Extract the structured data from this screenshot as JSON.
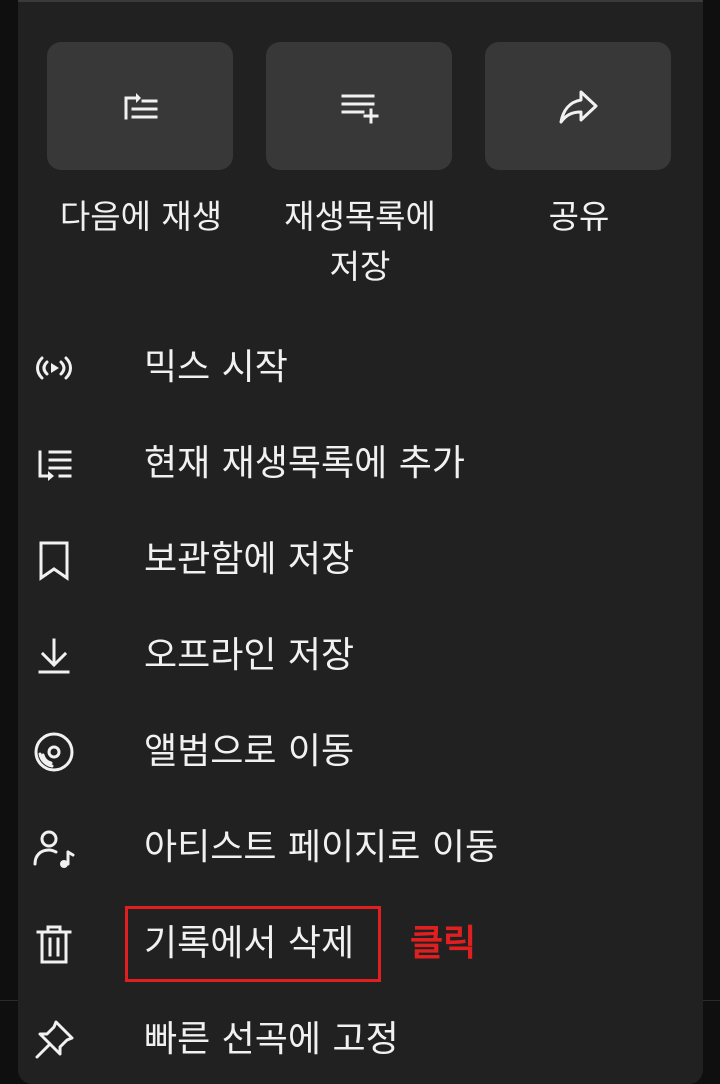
{
  "quick_actions": [
    {
      "label": "다음에 재생",
      "icon": "play-next-icon"
    },
    {
      "label": "재생목록에\n저장",
      "icon": "playlist-add-icon"
    },
    {
      "label": "공유",
      "icon": "share-icon"
    }
  ],
  "menu": [
    {
      "label": "믹스 시작",
      "icon": "radio-mix-icon"
    },
    {
      "label": "현재 재생목록에 추가",
      "icon": "queue-add-icon"
    },
    {
      "label": "보관함에 저장",
      "icon": "bookmark-icon"
    },
    {
      "label": "오프라인 저장",
      "icon": "download-icon"
    },
    {
      "label": "앨범으로 이동",
      "icon": "album-icon"
    },
    {
      "label": "아티스트 페이지로 이동",
      "icon": "artist-icon"
    },
    {
      "label": "기록에서 삭제",
      "icon": "trash-icon"
    },
    {
      "label": "빠른 선곡에 고정",
      "icon": "pin-icon"
    }
  ],
  "annotation": {
    "text": "클릭",
    "color": "#e02020"
  },
  "colors": {
    "sheet_background": "#212121",
    "tile_background": "#383838",
    "text": "#f1f1f1",
    "page_background": "#0f0f0f"
  }
}
